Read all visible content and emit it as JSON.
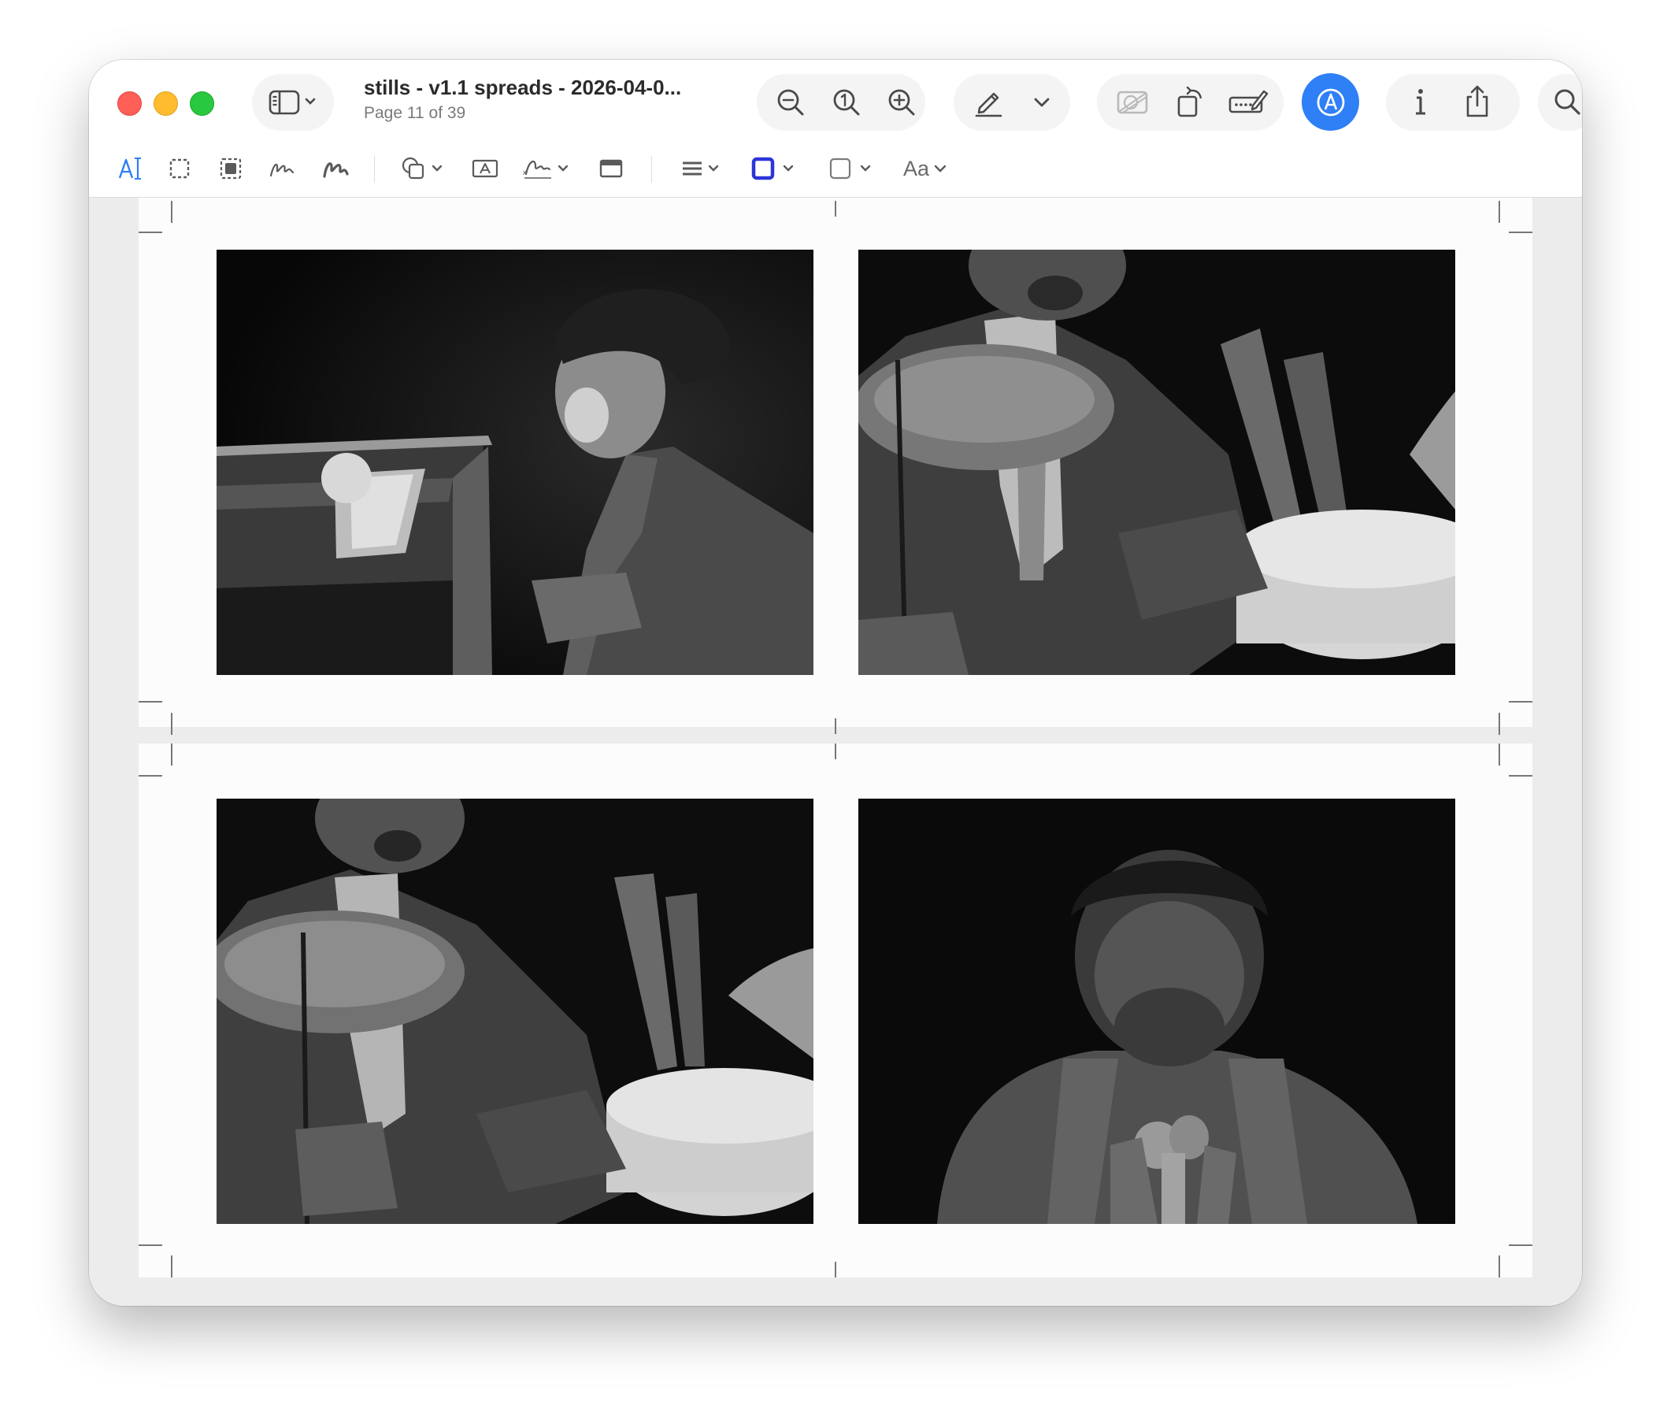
{
  "window": {
    "title": "stills - v1.1 spreads - 2026-04-0...",
    "subtitle": "Page 11 of 39"
  },
  "toolbar": {
    "icons": [
      "sidebar-icon",
      "zoom-out-icon",
      "actual-size-icon",
      "zoom-in-icon",
      "highlight-pen-icon",
      "chevron-down-icon",
      "crop-image-icon",
      "rotate-icon",
      "form-fill-icon",
      "markup-icon",
      "info-icon",
      "share-icon",
      "search-icon"
    ]
  },
  "markup_toolbar": {
    "text_style_label": "Aa",
    "colors": {
      "border_color": "#2c35d8",
      "accent": "#2f7ff6"
    }
  },
  "pages": [
    {
      "images": [
        "pianist-at-organ",
        "drummer-with-cymbal",
        "drummer-at-kit",
        "trumpeter-with-microphone"
      ]
    }
  ]
}
